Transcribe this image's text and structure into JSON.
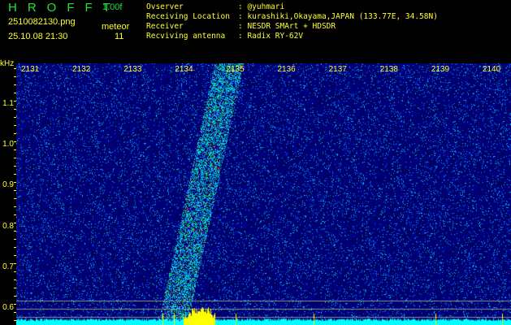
{
  "header": {
    "app_title": "HROFFT",
    "version": "1.00f",
    "filename": "2510082130.png",
    "datetime": "25.10.08 21:30",
    "detection_label": "meteor",
    "detection_count": "11"
  },
  "info": [
    {
      "label": "Ovserver            ",
      "value": ": @yuhmari"
    },
    {
      "label": "Receiving Location  ",
      "value": ": kurashiki,Okayama,JAPAN (133.77E, 34.58N)"
    },
    {
      "label": "Receiver            ",
      "value": ": NESDR SMArt + HDSDR"
    },
    {
      "label": "Recviving antenna   ",
      "value": ": Radix RY-62V"
    }
  ],
  "axis": {
    "y_unit": "kHz",
    "y_labels": [
      "1.1",
      "1.0",
      "0.9",
      "0.8",
      "0.7",
      "0.6"
    ],
    "x_labels": [
      "2131",
      "2132",
      "2133",
      "2134",
      "2135",
      "2136",
      "2137",
      "2138",
      "2139",
      "2140"
    ]
  },
  "colors": {
    "text": "#ffff30",
    "title": "#22e03a",
    "spectrum": "#00ffff",
    "peak": "#ffff00"
  }
}
